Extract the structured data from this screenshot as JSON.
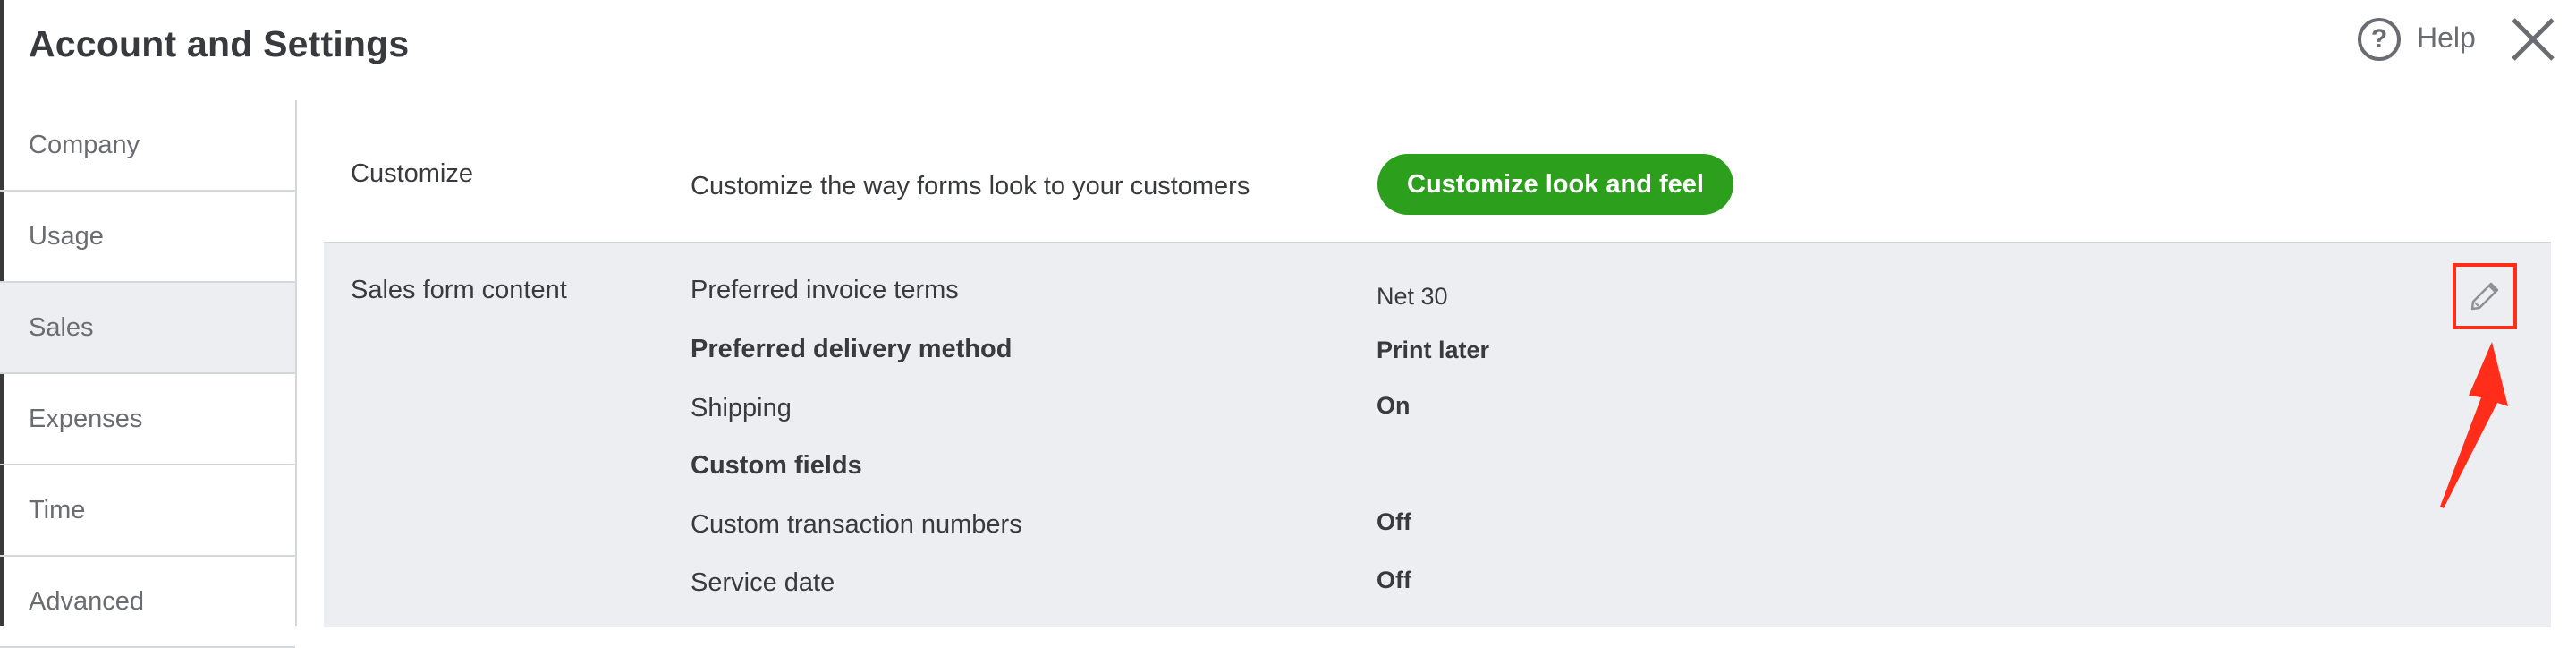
{
  "header": {
    "title": "Account and Settings",
    "help_label": "Help"
  },
  "sidebar": {
    "items": [
      {
        "label": "Company"
      },
      {
        "label": "Usage"
      },
      {
        "label": "Sales",
        "active": true
      },
      {
        "label": "Expenses"
      },
      {
        "label": "Time"
      },
      {
        "label": "Advanced"
      }
    ]
  },
  "customize": {
    "section_label": "Customize",
    "description": "Customize the way forms look to your customers",
    "button_label": "Customize look and feel"
  },
  "sales_form": {
    "section_label": "Sales form content",
    "rows": [
      {
        "label": "Preferred invoice terms",
        "value": "Net 30"
      },
      {
        "label": "Preferred delivery method",
        "value": "Print later"
      },
      {
        "label": "Shipping",
        "value": "On"
      },
      {
        "label": "Custom fields",
        "value": ""
      },
      {
        "label": "Custom transaction numbers",
        "value": "Off"
      },
      {
        "label": "Service date",
        "value": "Off"
      }
    ]
  },
  "colors": {
    "accent_green": "#2ca01c",
    "panel_bg": "#eceef1",
    "annotation_red": "#ff2d1a"
  },
  "icons": [
    "help-icon",
    "close-icon",
    "pencil-edit-icon"
  ]
}
